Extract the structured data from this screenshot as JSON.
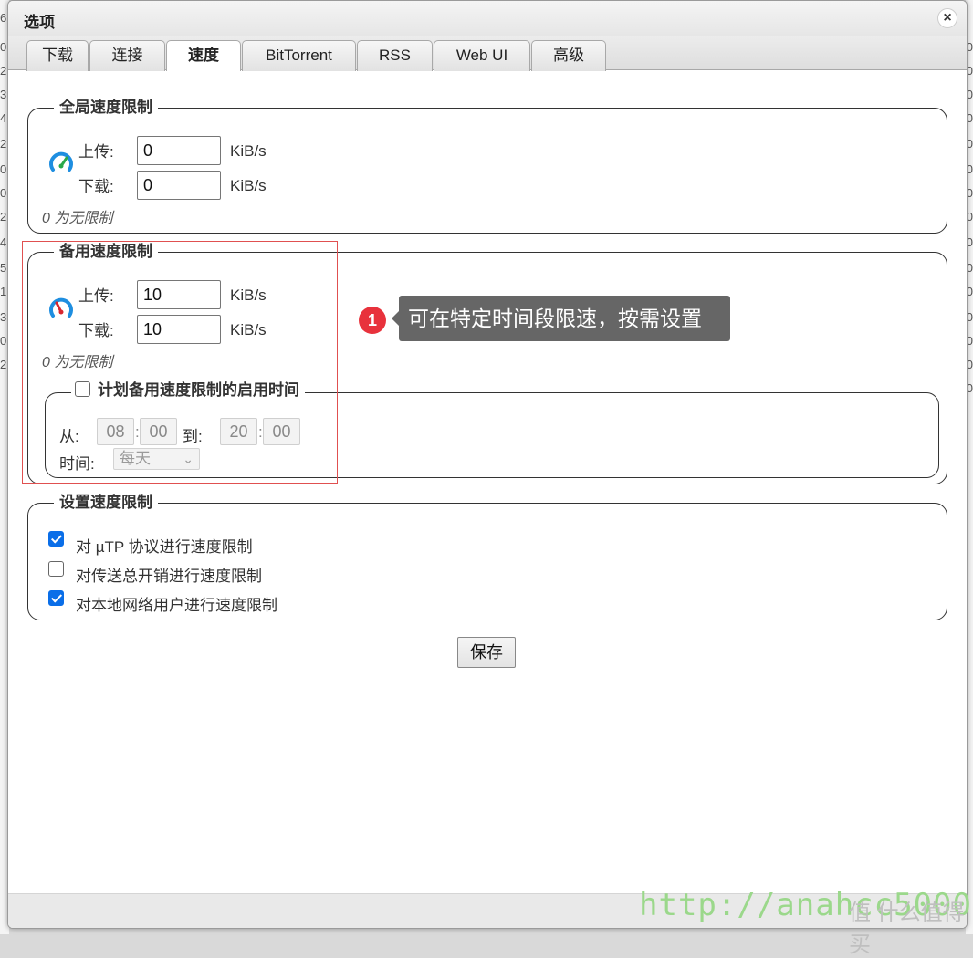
{
  "dialog": {
    "title": "选项",
    "close_glyph": "×"
  },
  "tabs": [
    {
      "label": "下载"
    },
    {
      "label": "连接"
    },
    {
      "label": "速度",
      "active": true
    },
    {
      "label": "BitTorrent"
    },
    {
      "label": "RSS"
    },
    {
      "label": "Web UI"
    },
    {
      "label": "高级"
    }
  ],
  "global_limit": {
    "legend": "全局速度限制",
    "upload_label": "上传:",
    "upload_value": "0",
    "download_label": "下载:",
    "download_value": "0",
    "unit": "KiB/s",
    "hint": "0 为无限制",
    "icon": "speedometer-green-icon"
  },
  "alt_limit": {
    "legend": "备用速度限制",
    "upload_label": "上传:",
    "upload_value": "10",
    "download_label": "下载:",
    "download_value": "10",
    "unit": "KiB/s",
    "hint": "0 为无限制",
    "icon": "speedometer-red-icon",
    "schedule": {
      "legend": "计划备用速度限制的启用时间",
      "checked": false,
      "from_label": "从:",
      "from_hour": "08",
      "from_min": "00",
      "to_label": "到:",
      "to_hour": "20",
      "to_min": "00",
      "colon": ":",
      "days_label": "时间:",
      "days_value": "每天"
    }
  },
  "settings": {
    "legend": "设置速度限制",
    "options": [
      {
        "label": "对 µTP 协议进行速度限制",
        "checked": true
      },
      {
        "label": "对传送总开销进行速度限制",
        "checked": false
      },
      {
        "label": "对本地网络用户进行速度限制",
        "checked": true
      }
    ]
  },
  "save_label": "保存",
  "annotation": {
    "number": "1",
    "text": "可在特定时间段限速，按需设置"
  },
  "watermark": {
    "url": "http://anahcc5000",
    "site": "值 什么值得买"
  },
  "background": {
    "left_digits": [
      "6",
      "0",
      "2",
      "3",
      "4",
      "2",
      "0",
      "0",
      "2",
      "4",
      "5",
      "1",
      "3",
      "0",
      "2"
    ],
    "right_digits": [
      "0",
      "0",
      "0",
      "0",
      "0",
      "0",
      "0",
      "0",
      "0",
      "0",
      "0",
      "0",
      "0",
      "0",
      "0"
    ]
  },
  "colors": {
    "accent": "#0a6ee8",
    "badge": "#e8323c",
    "callout_bg": "#666666",
    "watermark": "#9bd88b"
  }
}
